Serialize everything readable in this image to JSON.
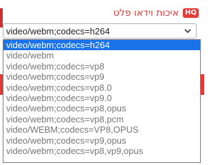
{
  "quality_label": "איכות וידאו פלט",
  "badge": "HQ",
  "select": {
    "value": "video/webm;codecs=h264",
    "options": [
      "video/webm;codecs=h264",
      "video/webm",
      "video/webm;codecs=vp8",
      "video/webm;codecs=vp9",
      "video/webm;codecs=vp8.0",
      "video/webm;codecs=vp9.0",
      "video/webm;codecs=vp8,opus",
      "video/webm;codecs=vp8,pcm",
      "video/WEBM;codecs=VP8,OPUS",
      "video/webm;codecs=vp9,opus",
      "video/webm;codecs=vp8,vp9,opus"
    ],
    "selected_index": 0
  },
  "colors": {
    "accent": "#e53935",
    "selection": "#1a73e8"
  }
}
